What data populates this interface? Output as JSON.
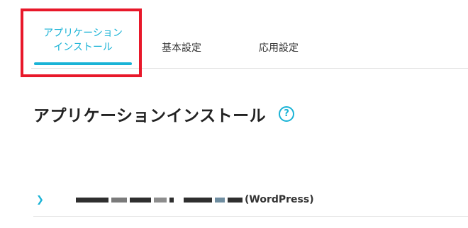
{
  "tabs": {
    "active": "アプリケーションインストール",
    "basic": "基本設定",
    "app": "応用設定"
  },
  "main": {
    "title": "アプリケーションインストール",
    "help_icon": "?"
  },
  "app_list": {
    "items": [
      {
        "expand_icon": "❯",
        "name_suffix": "(WordPress)"
      }
    ]
  },
  "colors": {
    "accent": "#1ab3d6",
    "highlight": "#e8182a"
  }
}
